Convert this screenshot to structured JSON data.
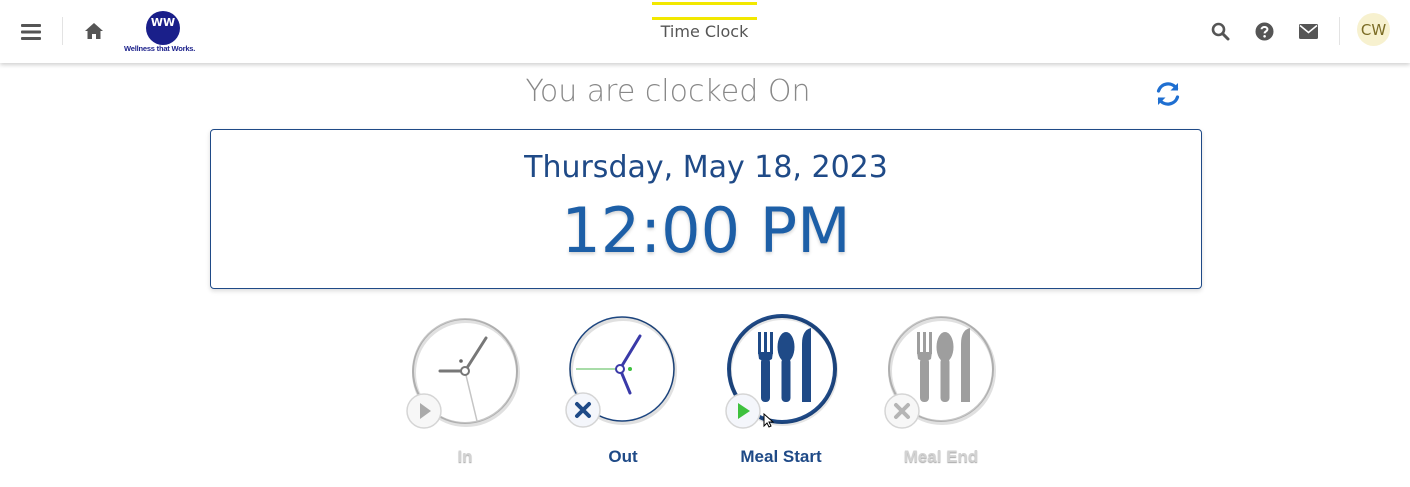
{
  "header": {
    "menu_icon": "hamburger-menu-icon",
    "home_icon": "home-icon",
    "logo_mark": "WW",
    "logo_text": "Wellness that Works.",
    "active_tab": "Time Clock",
    "search_icon": "search-icon",
    "help_icon": "question-circle-icon",
    "mail_icon": "envelope-icon",
    "user_initials": "CW"
  },
  "colors": {
    "accent_yellow": "#f2e800",
    "primary_blue": "#1f4a87",
    "time_blue": "#1d5fa7",
    "play_green": "#3ec13e"
  },
  "status": {
    "text": "You are clocked On",
    "refresh_icon": "refresh-icon"
  },
  "clock": {
    "date": "Thursday, May 18, 2023",
    "time": "12:00 PM"
  },
  "actions": [
    {
      "label": "In",
      "icon": "clock-in-icon",
      "badge_icon": "play-icon",
      "state": "disabled"
    },
    {
      "label": "Out",
      "icon": "clock-out-icon",
      "badge_icon": "close-icon",
      "state": "enabled"
    },
    {
      "label": "Meal Start",
      "icon": "fork-spoon-knife-icon",
      "badge_icon": "play-icon",
      "state": "enabled-highlight"
    },
    {
      "label": "Meal End",
      "icon": "fork-spoon-knife-icon",
      "badge_icon": "close-icon",
      "state": "disabled"
    }
  ]
}
